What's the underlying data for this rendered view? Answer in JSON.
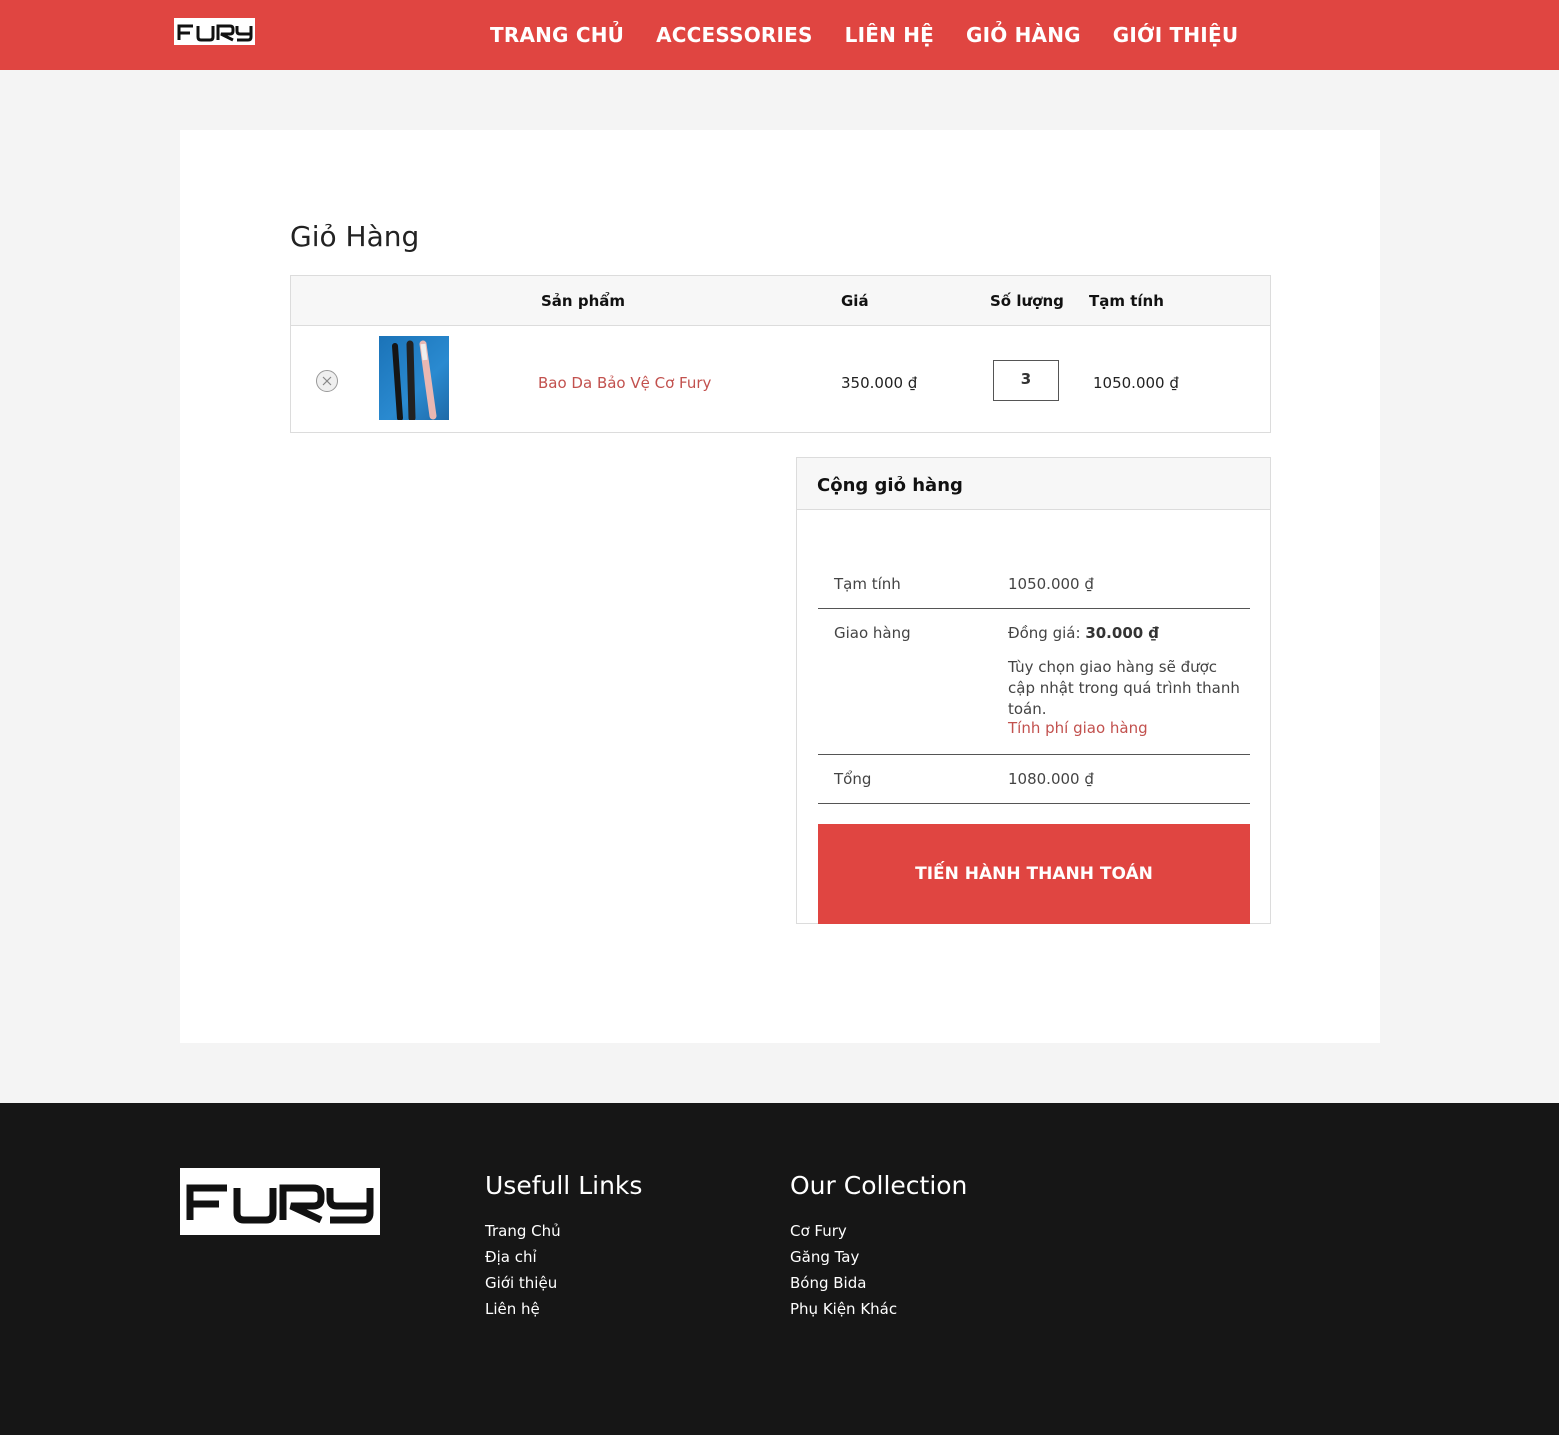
{
  "brand": {
    "logo_text": "FURY"
  },
  "nav": {
    "items": [
      {
        "label": "TRANG CHỦ"
      },
      {
        "label": "ACCESSORIES"
      },
      {
        "label": "LIÊN HỆ"
      },
      {
        "label": "GIỎ HÀNG"
      },
      {
        "label": "GIỚI THIỆU"
      }
    ]
  },
  "cart": {
    "title": "Giỏ Hàng",
    "columns": {
      "product": "Sản phẩm",
      "price": "Giá",
      "quantity": "Số lượng",
      "subtotal": "Tạm tính"
    },
    "items": [
      {
        "name": "Bao Da Bảo Vệ Cơ Fury",
        "price": "350.000 ₫",
        "quantity": "3",
        "subtotal": "1050.000 ₫"
      }
    ]
  },
  "totals": {
    "title": "Cộng giỏ hàng",
    "subtotal_label": "Tạm tính",
    "subtotal_value": "1050.000 ₫",
    "shipping_label": "Giao hàng",
    "shipping_prefix": "Đồng giá: ",
    "shipping_value": "30.000 ₫",
    "shipping_note": "Tùy chọn giao hàng sẽ được cập nhật trong quá trình thanh toán.",
    "shipping_calc_link": "Tính phí giao hàng",
    "total_label": "Tổng",
    "total_value": "1080.000 ₫",
    "checkout_label": "TIẾN HÀNH THANH TOÁN"
  },
  "footer": {
    "links_title": "Usefull Links",
    "links": [
      {
        "label": "Trang Chủ"
      },
      {
        "label": "Địa chỉ"
      },
      {
        "label": "Giới thiệu"
      },
      {
        "label": "Liên hệ"
      }
    ],
    "collection_title": "Our Collection",
    "collection": [
      {
        "label": "Cơ Fury"
      },
      {
        "label": "Găng Tay"
      },
      {
        "label": "Bóng Bida"
      },
      {
        "label": "Phụ Kiện Khác"
      }
    ]
  },
  "colors": {
    "brand_red": "#e04541",
    "link_red": "#c2514e",
    "footer_bg": "#161616",
    "page_bg": "#f4f4f4"
  }
}
